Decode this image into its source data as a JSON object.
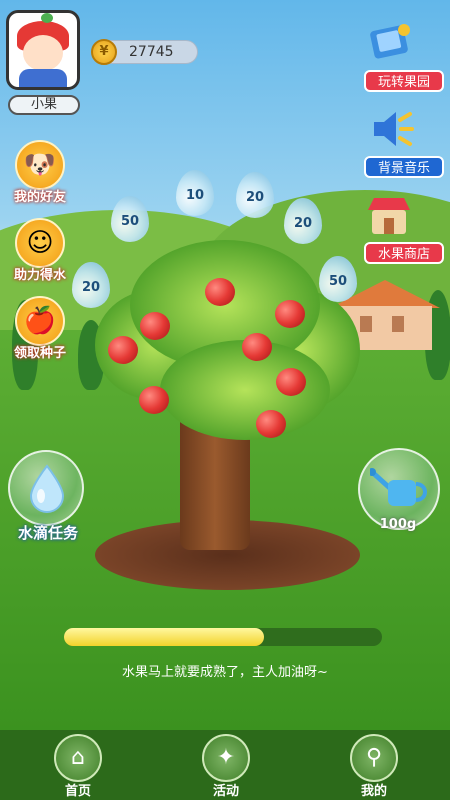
{
  "profile": {
    "name": "小果"
  },
  "coins": {
    "value": "27745",
    "icon": "coin-icon"
  },
  "right_menu": [
    {
      "label": "玩转果园",
      "icon": "orchard-book-icon"
    },
    {
      "label": "背景音乐",
      "icon": "speaker-icon"
    },
    {
      "label": "水果商店",
      "icon": "shop-icon"
    }
  ],
  "left_menu": [
    {
      "label": "我的好友",
      "icon": "friends-icon"
    },
    {
      "label": "助力得水",
      "icon": "smiley-icon"
    },
    {
      "label": "领取种子",
      "icon": "apple-seed-icon"
    }
  ],
  "drops": [
    "50",
    "10",
    "20",
    "20",
    "20",
    "50"
  ],
  "water_task": {
    "label": "水滴任务"
  },
  "watering": {
    "amount": "100g"
  },
  "progress": {
    "fraction": 0.63,
    "text": "水果马上就要成熟了，主人加油呀~"
  },
  "nav": [
    {
      "label": "首页",
      "icon": "home-icon"
    },
    {
      "label": "活动",
      "icon": "party-icon"
    },
    {
      "label": "我的",
      "icon": "user-icon"
    }
  ],
  "colors": {
    "red_button": "#e8394a",
    "blue_button": "#1f67d2",
    "nav_bg": "#2c6a1a",
    "progress_fill": "#f2d22a"
  }
}
